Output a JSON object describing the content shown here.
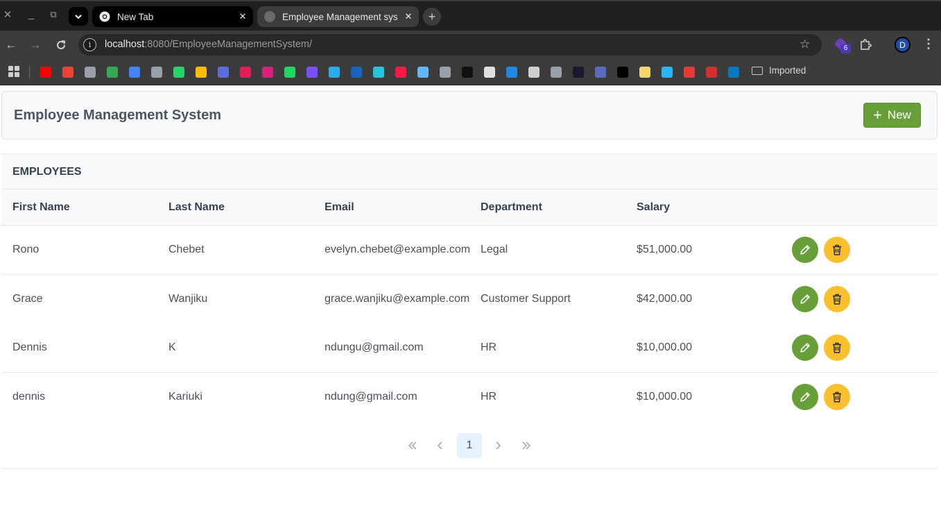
{
  "browser": {
    "tabs": [
      {
        "title": "New Tab",
        "active": false
      },
      {
        "title": "Employee Management sys",
        "active": true
      }
    ],
    "url_host": "localhost",
    "url_path": ":8080/EmployeeManagementSystem/",
    "extension_badge": "6",
    "profile_initial": "D",
    "bookmarks_folder": "Imported",
    "bookmark_icons": [
      {
        "name": "youtube-bookmark-icon",
        "color": "#ff0000"
      },
      {
        "name": "gmail-bookmark-icon",
        "color": "#ea4335"
      },
      {
        "name": "globe-bookmark-icon",
        "color": "#9aa0a6"
      },
      {
        "name": "maps-bookmark-icon",
        "color": "#34a853"
      },
      {
        "name": "translate-bookmark-icon",
        "color": "#4285f4"
      },
      {
        "name": "globe-bookmark-icon",
        "color": "#9aa0a6"
      },
      {
        "name": "whatsapp-bookmark-icon",
        "color": "#25d366"
      },
      {
        "name": "drive-bookmark-icon",
        "color": "#fbbc04"
      },
      {
        "name": "calendar-bookmark-icon",
        "color": "#5b6bd8"
      },
      {
        "name": "slack-bookmark-icon",
        "color": "#e01e5a"
      },
      {
        "name": "creative-cloud-bookmark-icon",
        "color": "#da1f7b"
      },
      {
        "name": "spotify-bookmark-icon",
        "color": "#1ed760"
      },
      {
        "name": "feather-bookmark-icon",
        "color": "#7c4dff"
      },
      {
        "name": "telegram-bookmark-icon",
        "color": "#2aabee"
      },
      {
        "name": "bookmark-icon",
        "color": "#1565c0"
      },
      {
        "name": "arc-bookmark-icon",
        "color": "#26c6da"
      },
      {
        "name": "news-bookmark-icon",
        "color": "#ff1744"
      },
      {
        "name": "chat-bookmark-icon",
        "color": "#64b5f6"
      },
      {
        "name": "globe-bookmark-icon",
        "color": "#9aa0a6"
      },
      {
        "name": "minus-bookmark-icon",
        "color": "#111111"
      },
      {
        "name": "cube-bookmark-icon",
        "color": "#e0e0e0"
      },
      {
        "name": "q-bookmark-icon",
        "color": "#1e88e5"
      },
      {
        "name": "network-bookmark-icon",
        "color": "#cfcfcf"
      },
      {
        "name": "globe-bookmark-icon",
        "color": "#9aa0a6"
      },
      {
        "name": "s-bookmark-icon",
        "color": "#1a1a2e"
      },
      {
        "name": "terminal-bookmark-icon",
        "color": "#5c6bc0"
      },
      {
        "name": "medium-bookmark-icon",
        "color": "#000000"
      },
      {
        "name": "avatar-bookmark-icon",
        "color": "#f5d76e"
      },
      {
        "name": "k-bookmark-icon",
        "color": "#29b6f6"
      },
      {
        "name": "acrobat-bookmark-icon",
        "color": "#e53935"
      },
      {
        "name": "window-bookmark-icon",
        "color": "#d32f2f"
      },
      {
        "name": "drupal-bookmark-icon",
        "color": "#0678be"
      }
    ]
  },
  "app": {
    "title": "Employee Management System",
    "new_button": "New",
    "accent": "#689f38",
    "danger": "#fbc02d"
  },
  "table": {
    "caption": "EMPLOYEES",
    "columns": [
      "First Name",
      "Last Name",
      "Email",
      "Department",
      "Salary"
    ],
    "rows": [
      {
        "first": "Rono",
        "last": "Chebet",
        "email": "evelyn.chebet@example.com",
        "department": "Legal",
        "salary": "$51,000.00"
      },
      {
        "first": "Grace",
        "last": "Wanjiku",
        "email": "grace.wanjiku@example.com",
        "department": "Customer Support",
        "salary": "$42,000.00"
      },
      {
        "first": "Dennis",
        "last": "K",
        "email": "ndungu@gmail.com",
        "department": "HR",
        "salary": "$10,000.00"
      },
      {
        "first": "dennis",
        "last": "Kariuki",
        "email": "ndung@gmail.com",
        "department": "HR",
        "salary": "$10,000.00"
      }
    ]
  },
  "paginator": {
    "current_page": "1"
  }
}
